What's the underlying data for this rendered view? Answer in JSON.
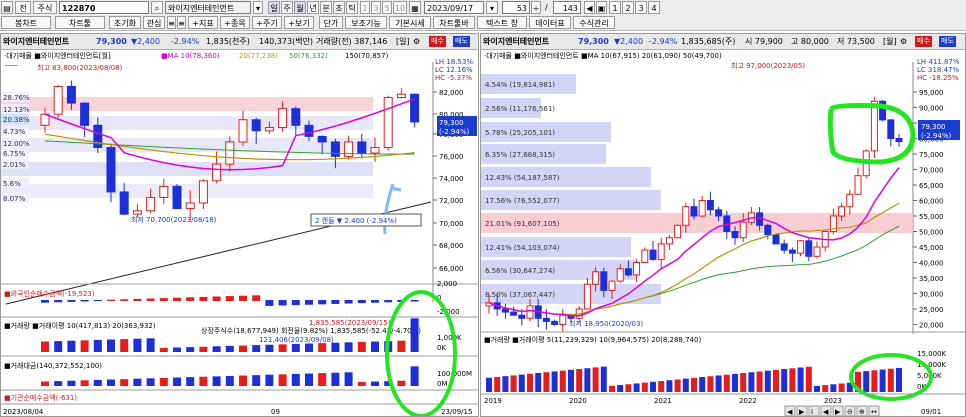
{
  "toolbar1": {
    "btn_jeon": "전",
    "btn_jusik": "주식",
    "code": "122870",
    "name": "와이지엔터테인먼트",
    "periods": [
      "일",
      "주",
      "월",
      "년",
      "분",
      "초",
      "틱"
    ],
    "nums": [
      "1",
      "3",
      "5",
      "10"
    ],
    "date": "2023/09/17",
    "count": "53",
    "count2": "143",
    "pages": [
      "1",
      "2",
      "3",
      "4"
    ]
  },
  "toolbar2": {
    "buttons": [
      "봉차트",
      "차트툴",
      "초기화",
      "관심",
      "지표",
      "종목",
      "주기",
      "보기",
      "단가",
      "보조기능",
      "기본시세",
      "차트툴바",
      "텍스트 창",
      "데이터표",
      "수식관리"
    ],
    "prefix": [
      "≡",
      "≡",
      "+",
      "+",
      "+"
    ]
  },
  "left": {
    "name": "와이지엔터테인먼트",
    "price": "79,300",
    "change": "▼2,400",
    "rate": "-2.94%",
    "vol_thousand": "1,835(천주)",
    "amount": "140,373(백만)",
    "amount_prev": "거래량(전) 387,146",
    "tag_il": "[일]",
    "tag_buy": "매수",
    "tag_sell": "매도",
    "ma_line": "·대기매물 ■와이지엔터테인먼트[월]",
    "ma_list": [
      "■MA 10(78,360)",
      "20(77,238)",
      "50(76,332)",
      "150(70,857)"
    ],
    "high_label": "최고 83,800(2023/08/08)",
    "low_label": "최저 70,700(2023/08/18)",
    "lh": "LH  18.53%",
    "lc": "LC  12.16%",
    "hc": "HC  -5.37%",
    "pct_labels": [
      "28.76%",
      "12.13%",
      "20.38%",
      "4.73%",
      "12.00%",
      "6.75%",
      "2.01%",
      "5.6%",
      "8.07%"
    ],
    "y_ticks": [
      "82,000",
      "80,000",
      "78,000",
      "76,000",
      "74,000",
      "72,000",
      "70,000",
      "68,000",
      "66,000"
    ],
    "cur_price_box": "79,300",
    "cur_rate_box": "(-2.94%)",
    "tooltip": "2 캔들  ▼ 2.400  (-2.94%)",
    "foreign_label": "■외국인순매수금액(-19,523)",
    "foreign_right": [
      "2,000",
      "0",
      "-2,000"
    ],
    "volume_label": "■거래량 ■거래이평 10(417,813)  20(363,932)",
    "volume_ann": "상장주식수(18,677,949) 회전율(9.82%) 1,835,585(-52.47/-4.70%)",
    "volume_ann2": "121,406(2023/09/08)",
    "volume_ann3": "1,835,585(2023/09/15)",
    "volume_right": [
      "1,000K",
      "0K"
    ],
    "amount_label": "■거래대금(140,372,552,100)",
    "amount_right": [
      "100,000M",
      "0M"
    ],
    "inst_label": "■기관순매수금액(-631)",
    "date_left": "2023/08/04",
    "date_mid": "09",
    "date_right": "23/09/15"
  },
  "right": {
    "name": "와이지엔터테인먼트",
    "price": "79,300",
    "change": "▼2,400",
    "rate": "-2.94%",
    "vol": "1,835,685(주)",
    "open": "시 79,900",
    "high": "고 80,000",
    "low": "저 73,500",
    "tag_w": "[월]",
    "tag_buy": "매수",
    "tag_sell": "매도",
    "ma_line": "·대기매물 ■와이지엔터테인먼트 ■MA 10(67,915)  20(61,090)  50(49,700)",
    "high_label": "최고 97,000(2023/05)",
    "low_label": "최저 18,950(2020/03)",
    "lh": "LH  411.87%",
    "lc": "LC  318.47%",
    "hc": "HC  -18.25%",
    "profile_labels": [
      "4.54%  (19,814,981)",
      "2.56%  (11,176,561)",
      "5.78%  (25,205,101)",
      "6.35%  (27,668,315)",
      "12.43%  (54,187,587)",
      "17.56%  (76,552,077)",
      "21.01%  (91,607,105)",
      "12.41%  (54,103,074)",
      "6.56%  (30,647,274)",
      "8.50%  (37,067,447)"
    ],
    "y_ticks": [
      "95,000",
      "90,000",
      "85,000",
      "80,000",
      "75,000",
      "70,000",
      "65,000",
      "60,000",
      "55,000",
      "50,000",
      "45,000",
      "40,000",
      "35,000",
      "30,000",
      "25,000",
      "20,000"
    ],
    "cur_price_box": "79,300",
    "cur_rate_box": "(-2.94%)",
    "volume_label": "■거래량 ■거래이평 5(11,239,329)  10(9,964,575)  20(8,288,740)",
    "volume_right": [
      "15,000K",
      "10,000K",
      "5,000K",
      "0K"
    ],
    "years": [
      "2019",
      "2020",
      "2021",
      "2022",
      "2023"
    ],
    "date_right": "09/01"
  },
  "colors": {
    "up": "#e81c1c",
    "down": "#1c2fd8",
    "ma_short": "#e000e0",
    "ma_mid": "#b89400",
    "ma_long": "#30a030",
    "highlight": "#22e622",
    "profile": "#ccccf4",
    "profile_hot": "#f7c4cc"
  }
}
